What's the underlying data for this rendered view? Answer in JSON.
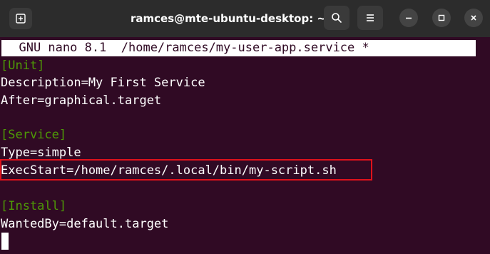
{
  "window": {
    "title": "ramces@mte-ubuntu-desktop: ~"
  },
  "icons": {
    "new_tab": "new-tab-icon",
    "search": "search-icon",
    "menu": "hamburger-menu-icon",
    "minimize": "minimize-icon",
    "maximize": "maximize-icon",
    "close": "close-icon"
  },
  "colors": {
    "terminal_bg": "#300a24",
    "section_header": "#4e9a06",
    "highlight_border": "#e0121b",
    "titlebar_bg": "#2c2c2c"
  },
  "editor": {
    "header": "  GNU nano 8.1  /home/ramces/my-user-app.service *",
    "lines": [
      "[Unit]",
      "Description=My First Service",
      "After=graphical.target",
      "",
      "[Service]",
      "Type=simple",
      "ExecStart=/home/ramces/.local/bin/my-script.sh",
      "",
      "[Install]",
      "WantedBy=default.target"
    ]
  }
}
